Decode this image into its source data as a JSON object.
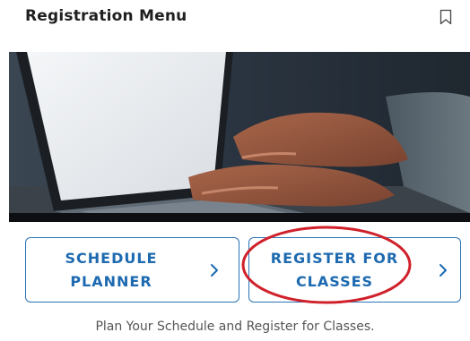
{
  "header": {
    "title": "Registration Menu",
    "bookmark_icon": "bookmark-outline-icon"
  },
  "hero": {
    "image": "person-typing-on-laptop-photo"
  },
  "buttons": [
    {
      "label": "SCHEDULE\nPLANNER",
      "icon": "chevron-right-icon"
    },
    {
      "label": "REGISTER FOR\nCLASSES",
      "icon": "chevron-right-icon",
      "highlighted": true
    }
  ],
  "caption": "Plan Your Schedule and Register for Classes.",
  "colors": {
    "accent": "#1d6ab0",
    "button_border": "#2a73b6",
    "highlight_circle": "#d0212b",
    "caption": "#555555"
  }
}
